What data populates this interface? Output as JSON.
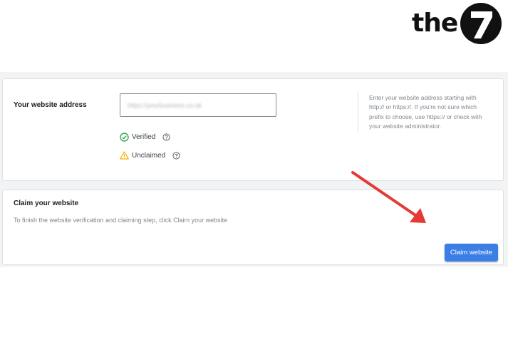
{
  "logo": {
    "text": "the",
    "badge": "7"
  },
  "address_card": {
    "label": "Your website address",
    "input_value": "https://yourbusiness.co.uk",
    "statuses": [
      {
        "icon": "check-circle-icon",
        "text": "Verified",
        "color": "#34a853"
      },
      {
        "icon": "warning-icon",
        "text": "Unclaimed",
        "color": "#f9ab00"
      }
    ],
    "hint": "Enter your website address starting with http:// or https://. If you're not sure which prefix to choose, use https:// or check with your website administrator."
  },
  "claim_card": {
    "title": "Claim your website",
    "description": "To finish the website verification and claiming step, click Claim your website",
    "button_label": "Claim website"
  },
  "colors": {
    "accent": "#3b7ee6",
    "arrow": "#e53935",
    "verified": "#34a853",
    "unclaimed": "#f9ab00"
  }
}
